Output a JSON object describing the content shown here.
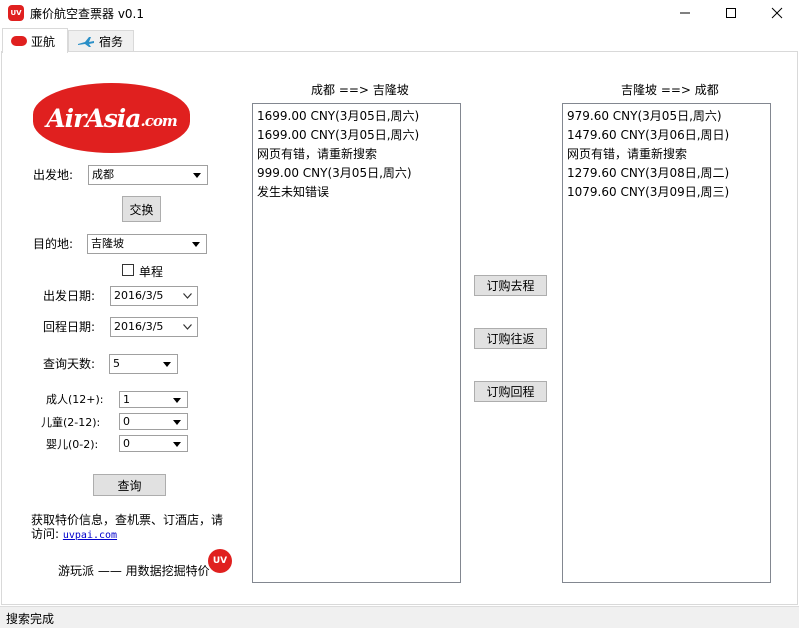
{
  "window": {
    "title": "廉价航空查票器 v0.1",
    "icon_text": "UV",
    "icon_color": "#e0201f"
  },
  "tabs": [
    {
      "label": "亚航",
      "icon": "airasia-icon"
    },
    {
      "label": "宿务",
      "icon": "airplane-icon"
    }
  ],
  "logo": {
    "main": "AirAsia",
    "suffix": ".com",
    "color": "#e0201f"
  },
  "form": {
    "departure_label": "出发地:",
    "departure_value": "成都",
    "swap_label": "交换",
    "destination_label": "目的地:",
    "destination_value": "吉隆坡",
    "oneway_label": "单程",
    "oneway_checked": false,
    "depart_date_label": "出发日期:",
    "depart_date_value": "2016/3/5",
    "return_date_label": "回程日期:",
    "return_date_value": "2016/3/5",
    "days_label": "查询天数:",
    "days_value": "5",
    "adult_label": "成人(12+):",
    "adult_value": "1",
    "child_label": "儿童(2-12):",
    "child_value": "0",
    "infant_label": "婴儿(0-2):",
    "infant_value": "0",
    "search_label": "查询"
  },
  "promo": {
    "line1": "获取特价信息，查机票、订酒店，请",
    "line2_prefix": "访问:",
    "link": "uvpai.com",
    "slogan": "游玩派 —— 用数据挖掘特价",
    "badge": "UV"
  },
  "outbound": {
    "header": "成都 ==> 吉隆坡",
    "items": [
      "1699.00 CNY(3月05日,周六)",
      "1699.00 CNY(3月05日,周六)",
      "网页有错，请重新搜索",
      "999.00 CNY(3月05日,周六)",
      "发生未知错误"
    ]
  },
  "inbound": {
    "header": "吉隆坡 ==> 成都",
    "items": [
      "979.60 CNY(3月05日,周六)",
      "1479.60 CNY(3月06日,周日)",
      "网页有错，请重新搜索",
      "1279.60 CNY(3月08日,周二)",
      "1079.60 CNY(3月09日,周三)"
    ]
  },
  "actions": {
    "book_outbound": "订购去程",
    "book_roundtrip": "订购往返",
    "book_return": "订购回程"
  },
  "status": {
    "text": "搜索完成"
  }
}
